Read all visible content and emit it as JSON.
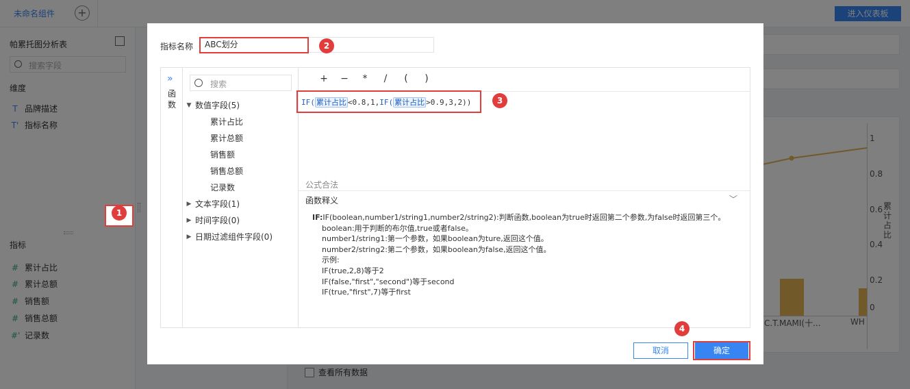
{
  "app": {
    "tab_name": "未命名组件",
    "enter_dashboard": "进入仪表板"
  },
  "left_panel": {
    "title": "帕累托图分析表",
    "search_placeholder": "搜索字段",
    "dimensions_label": "维度",
    "dimensions": [
      {
        "glyph": "T",
        "label": "品牌描述"
      },
      {
        "glyph": "T'",
        "label": "指标名称"
      }
    ],
    "metrics_label": "指标",
    "add_glyph": "+",
    "metrics": [
      {
        "glyph": "#",
        "label": "累计占比"
      },
      {
        "glyph": "#",
        "label": "累计总额"
      },
      {
        "glyph": "#",
        "label": "销售额"
      },
      {
        "glyph": "#",
        "label": "销售总额"
      },
      {
        "glyph": "#'",
        "label": "记录数"
      }
    ]
  },
  "chart": {
    "y_ticks": [
      "1",
      "0.8",
      "0.6",
      "0.4",
      "0.2",
      "0"
    ],
    "y_label": "累计占比",
    "x_categories": [
      "D.C.T.MAMI(十...",
      "WH"
    ],
    "bar_color": "#e3b255",
    "line_color": "#e3b255",
    "show_all_data": "查看所有数据"
  },
  "modal": {
    "name_label": "指标名称",
    "name_value": "ABC划分",
    "functions_label": "函数",
    "field_search_placeholder": "搜索",
    "tree": {
      "numeric_group": "数值字段(5)",
      "numeric_fields": [
        "累计占比",
        "累计总额",
        "销售额",
        "销售总额",
        "记录数"
      ],
      "text_group": "文本字段(1)",
      "time_group": "时间字段(0)",
      "date_filter_group": "日期过滤组件字段(0)"
    },
    "operators": [
      "+",
      "−",
      "*",
      "/",
      "(",
      ")"
    ],
    "formula": {
      "fn1": "IF(",
      "field1": "累计占比",
      "mid1": "<0.8,1,",
      "fn2": "IF(",
      "field2": "累计占比",
      "tail": ">0.9,3,2))"
    },
    "valid_text": "公式合法",
    "help_title": "函数释义",
    "help": {
      "head": "IF:",
      "signature": "IF(boolean,number1/string1,number2/string2):判断函数,boolean为true时返回第二个参数,为false时返回第三个。",
      "lines": [
        "boolean:用于判断的布尔值,true或者false。",
        "number1/string1:第一个参数，如果boolean为ture,返回这个值。",
        "number2/string2:第二个参数，如果boolean为false,返回这个值。",
        "示例:",
        "IF(true,2,8)等于2",
        "IF(false,\"first\",\"second\")等于second",
        "IF(true,\"first\",7)等于first"
      ]
    },
    "cancel_label": "取消",
    "ok_label": "确定"
  },
  "annotations": {
    "badge1": "1",
    "badge2": "2",
    "badge3": "3",
    "badge4": "4",
    "color": "#e23d3d"
  }
}
